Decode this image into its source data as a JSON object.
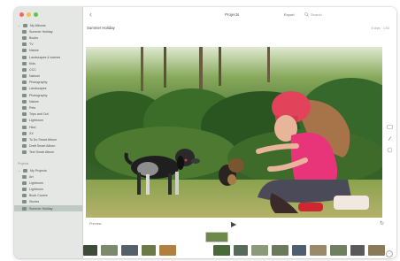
{
  "window": {
    "toolbar": {
      "title": "Projects",
      "export_label": "Export",
      "search_placeholder": "Search"
    },
    "subbar": {
      "clip_title": "Summer Holiday",
      "clip_info": "6 clips · 1:53"
    },
    "controls": {
      "left_label": "Preview"
    }
  },
  "sidebar": {
    "items": [
      {
        "label": "My Albums",
        "level": 0,
        "chevron": "v",
        "icon": "folder-icon"
      },
      {
        "label": "Summer Holiday",
        "level": 1,
        "icon": "album-icon"
      },
      {
        "label": "Books",
        "level": 1,
        "icon": "album-icon"
      },
      {
        "label": "TV",
        "level": 1,
        "icon": "album-icon"
      },
      {
        "label": "Nature",
        "level": 1,
        "icon": "album-icon"
      },
      {
        "label": "Landscapes & scenes",
        "level": 1,
        "icon": "album-icon"
      },
      {
        "label": "Kids",
        "level": 1,
        "icon": "album-icon"
      },
      {
        "label": "CCC",
        "level": 1,
        "icon": "album-icon"
      },
      {
        "label": "Natural",
        "level": 1,
        "icon": "album-icon"
      },
      {
        "label": "Photography",
        "level": 1,
        "icon": "album-icon"
      },
      {
        "label": "Landscapes",
        "level": 1,
        "icon": "album-icon"
      },
      {
        "label": "Photography",
        "level": 1,
        "icon": "album-icon"
      },
      {
        "label": "Nature",
        "level": 1,
        "icon": "album-icon"
      },
      {
        "label": "Pets",
        "level": 1,
        "icon": "album-icon"
      },
      {
        "label": "Trips and Out",
        "level": 1,
        "icon": "album-icon"
      },
      {
        "label": "Lightroom",
        "level": 1,
        "icon": "album-icon"
      },
      {
        "label": "Hiod",
        "level": 1,
        "icon": "album-icon"
      },
      {
        "label": "XX",
        "level": 1,
        "icon": "album-icon"
      },
      {
        "label": "To Do Smart Album",
        "level": 1,
        "icon": "smart-album-icon"
      },
      {
        "label": "Draft Smart Album",
        "level": 1,
        "icon": "smart-album-icon"
      },
      {
        "label": "Test Smart Album",
        "level": 1,
        "icon": "smart-album-icon"
      }
    ],
    "projects_section": "Projects",
    "projects": [
      {
        "label": "My Projects",
        "level": 0,
        "chevron": "v",
        "icon": "folder-icon"
      },
      {
        "label": "Art",
        "level": 1,
        "icon": "project-icon"
      },
      {
        "label": "Lightroom",
        "level": 1,
        "icon": "project-icon"
      },
      {
        "label": "Lightroom",
        "level": 1,
        "icon": "project-icon"
      },
      {
        "label": "Book Covers",
        "level": 1,
        "icon": "project-icon"
      },
      {
        "label": "Stories",
        "level": 1,
        "icon": "project-icon"
      },
      {
        "label": "Summer Holiday",
        "level": 1,
        "icon": "project-icon",
        "selected": true
      }
    ]
  },
  "filmstrip": {
    "thumbs": [
      "#3e4a3a",
      "#7a8a6a",
      "#55606a",
      "#6c7a4a",
      "#b08040",
      "#4a6a3a",
      "#5a6a5a",
      "#8a9a7a",
      "#6a7a5a",
      "#4e5e6e",
      "#9a8a6a",
      "#707f60",
      "#5a5a5a",
      "#8a7a5a"
    ]
  },
  "colors": {
    "sidebar_bg": "#e4e7e3",
    "selected_bg": "#bfc9c4",
    "helmet": "#e2435b",
    "shirt": "#e8357a"
  }
}
